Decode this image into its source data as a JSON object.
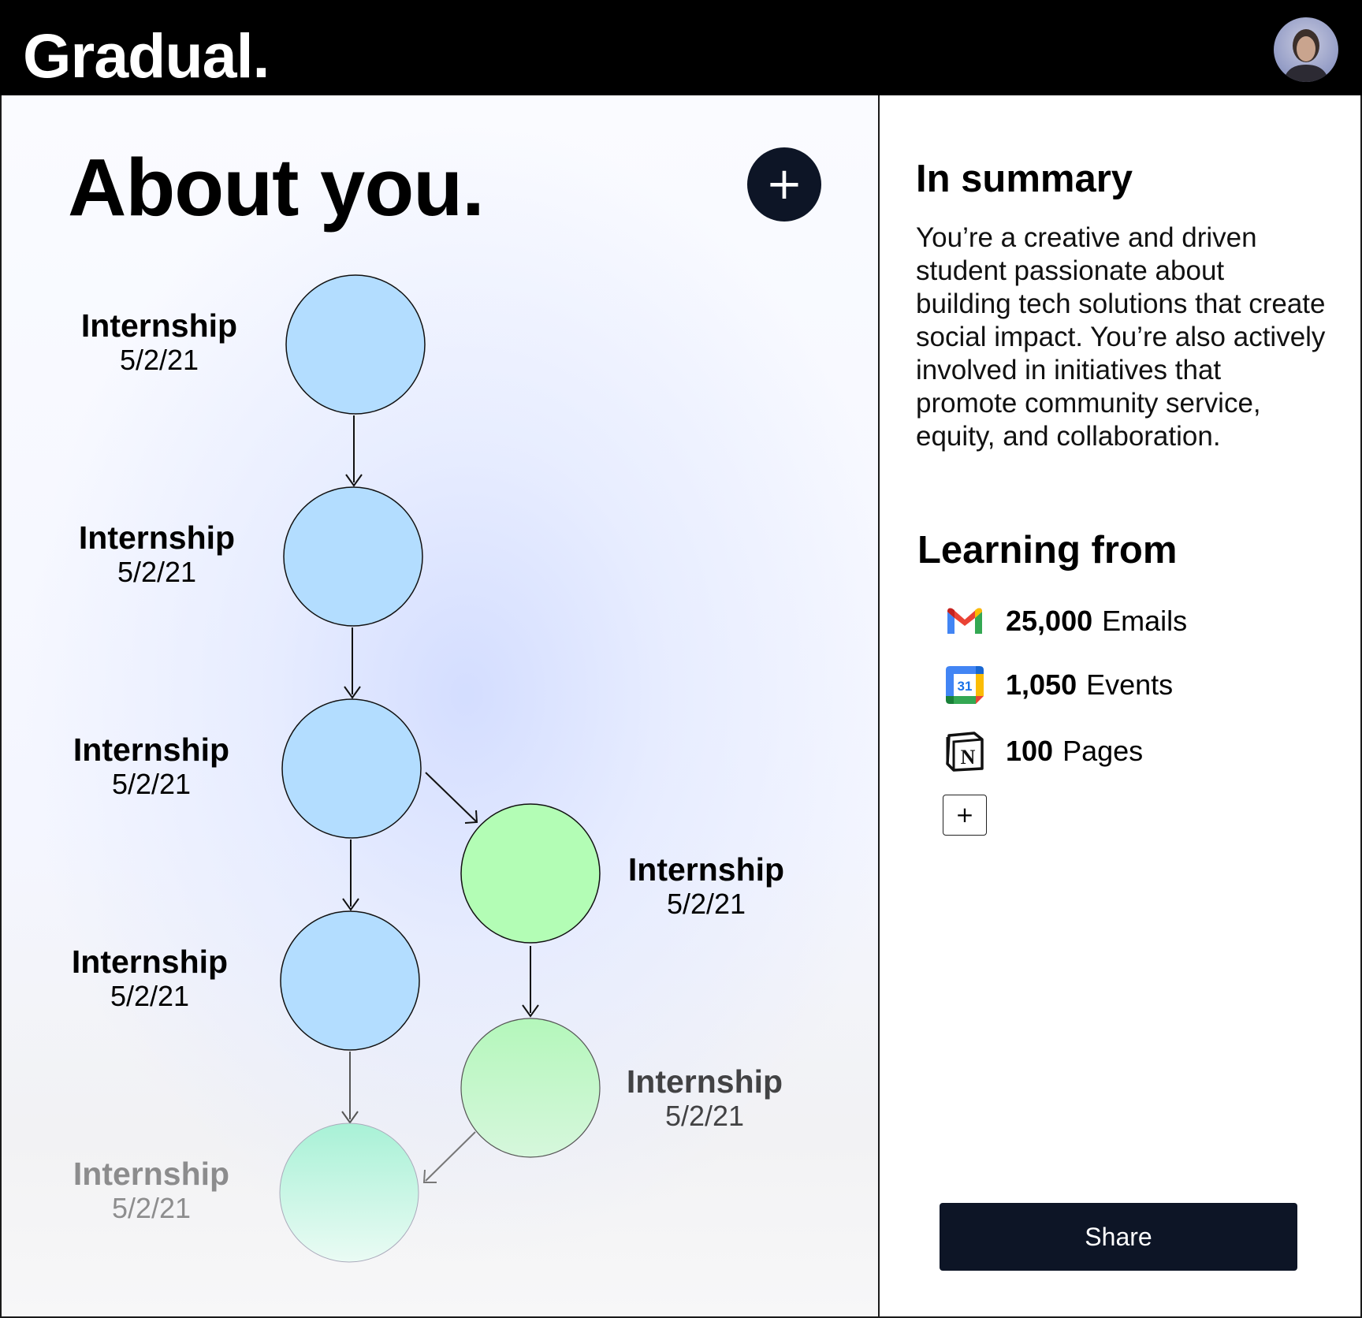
{
  "app": {
    "logo": "Gradual."
  },
  "header": {
    "avatar_icon": "user-avatar"
  },
  "main": {
    "title": "About you.",
    "add_label": "+",
    "timeline": {
      "nodes": [
        {
          "title": "Internship",
          "date": "5/2/21",
          "color": "#b3ddff"
        },
        {
          "title": "Internship",
          "date": "5/2/21",
          "color": "#b3ddff"
        },
        {
          "title": "Internship",
          "date": "5/2/21",
          "color": "#b3ddff"
        },
        {
          "title": "Internship",
          "date": "5/2/21",
          "color": "#b3ddff"
        },
        {
          "title": "Internship",
          "date": "5/2/21",
          "color": "#aef0d8"
        },
        {
          "title": "Internship",
          "date": "5/2/21",
          "color": "#b3fdb5"
        },
        {
          "title": "Internship",
          "date": "5/2/21",
          "color": "#b8f8bc"
        }
      ]
    }
  },
  "summary": {
    "title": "In summary",
    "text": "You’re a creative and driven student passionate about building tech solutions that create social impact. You’re also actively involved in initiatives that promote community service, equity, and collaboration.",
    "learning_title": "Learning from",
    "sources": [
      {
        "icon": "gmail-icon",
        "count": "25,000",
        "label": "Emails"
      },
      {
        "icon": "google-calendar-icon",
        "count": "1,050",
        "label": "Events",
        "icon_text": "31"
      },
      {
        "icon": "notion-icon",
        "count": "100",
        "label": "Pages",
        "icon_text": "N"
      }
    ],
    "add_source_label": "+",
    "share_label": "Share"
  }
}
